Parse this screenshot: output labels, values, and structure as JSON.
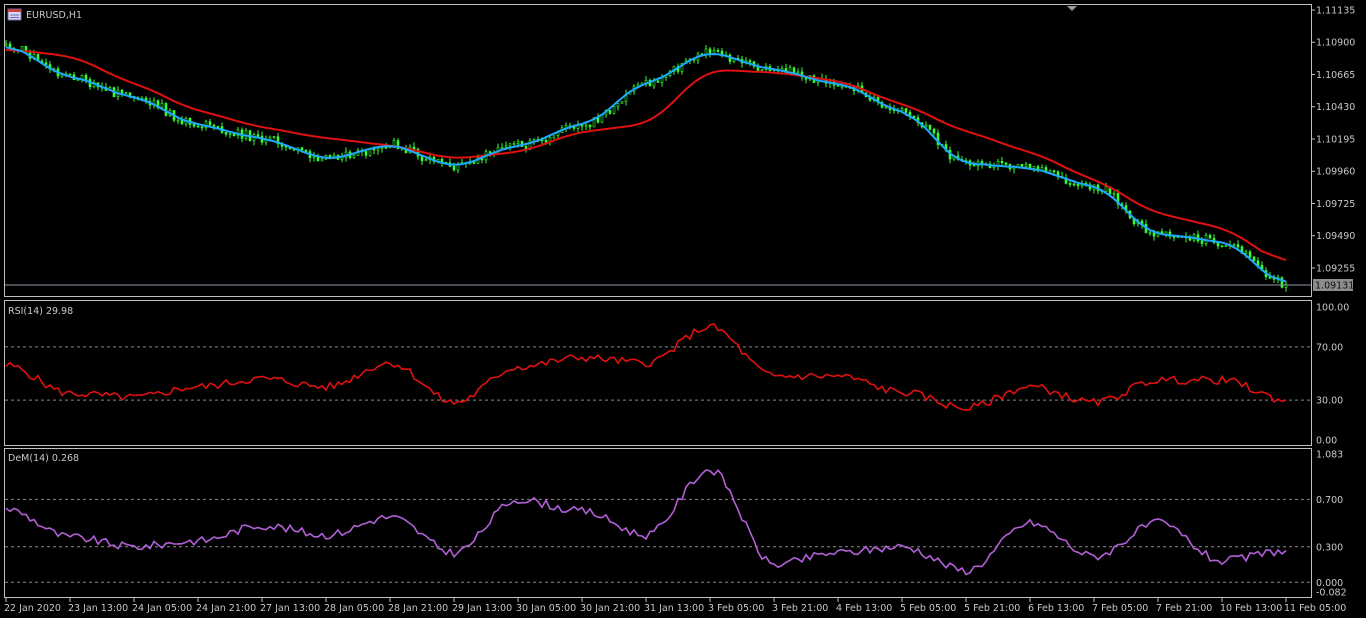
{
  "window": {
    "title": "EURUSD,H1",
    "symbol_icon": "chart-window-icon"
  },
  "colors": {
    "background": "#000000",
    "frame": "#c0c0c0",
    "grid_dash": "#8a8a8a",
    "candle_green": "#33ff33",
    "ma_fast": "#1ea8ff",
    "ma_slow": "#e01010",
    "rsi_line": "#e01010",
    "dem_line": "#b260d6",
    "current_price_box": "#8c8c8c"
  },
  "price_panel": {
    "ylabels": [
      "1.11135",
      "1.10900",
      "1.10665",
      "1.10430",
      "1.10195",
      "1.09960",
      "1.09725",
      "1.09490",
      "1.09255"
    ],
    "current_price": "1.09131"
  },
  "rsi_panel": {
    "label": "RSI(14) 29.98",
    "ylabels": [
      "100.00",
      "70.00",
      "30.00",
      "0.00"
    ],
    "levels": [
      70,
      30
    ]
  },
  "dem_panel": {
    "label": "DeM(14) 0.268",
    "ylabels": [
      "1.083",
      "0.700",
      "0.300",
      "0.000",
      "-0.082"
    ],
    "levels": [
      0.7,
      0.3,
      0.0
    ]
  },
  "time_axis": {
    "labels": [
      "22 Jan 2020",
      "23 Jan 13:00",
      "24 Jan 05:00",
      "24 Jan 21:00",
      "27 Jan 13:00",
      "28 Jan 05:00",
      "28 Jan 21:00",
      "29 Jan 13:00",
      "30 Jan 05:00",
      "30 Jan 21:00",
      "31 Jan 13:00",
      "3 Feb 05:00",
      "3 Feb 21:00",
      "4 Feb 13:00",
      "5 Feb 05:00",
      "5 Feb 21:00",
      "6 Feb 13:00",
      "7 Feb 05:00",
      "7 Feb 21:00",
      "10 Feb 13:00",
      "11 Feb 05:00"
    ]
  },
  "chart_data": [
    {
      "type": "line",
      "title": "EURUSD,H1",
      "x": [
        "22 Jan 2020",
        "23 Jan 13:00",
        "24 Jan 05:00",
        "24 Jan 21:00",
        "27 Jan 13:00",
        "28 Jan 05:00",
        "28 Jan 21:00",
        "29 Jan 13:00",
        "30 Jan 05:00",
        "30 Jan 21:00",
        "31 Jan 13:00",
        "3 Feb 05:00",
        "3 Feb 21:00",
        "4 Feb 13:00",
        "5 Feb 05:00",
        "5 Feb 21:00",
        "6 Feb 13:00",
        "7 Feb 05:00",
        "7 Feb 21:00",
        "10 Feb 13:00",
        "11 Feb 05:00"
      ],
      "series": [
        {
          "values": [
            1.1088,
            1.1065,
            1.105,
            1.103,
            1.102,
            1.1005,
            1.1015,
            1.1,
            1.1015,
            1.103,
            1.106,
            1.1082,
            1.107,
            1.106,
            1.104,
            1.1002,
            1.0998,
            1.0985,
            1.095,
            1.0945,
            1.0914
          ]
        },
        {
          "values": [
            1.1085,
            1.108,
            1.106,
            1.104,
            1.1028,
            1.102,
            1.1015,
            1.1005,
            1.101,
            1.1025,
            1.103,
            1.107,
            1.1068,
            1.1062,
            1.1045,
            1.1025,
            1.101,
            1.099,
            1.0965,
            1.0955,
            1.0928
          ]
        }
      ],
      "ylim": [
        1.09131,
        1.11135
      ],
      "current_price": 1.09131
    },
    {
      "type": "line",
      "title": "RSI(14) 29.98",
      "x": [
        "22 Jan 2020",
        "23 Jan 13:00",
        "24 Jan 05:00",
        "24 Jan 21:00",
        "27 Jan 13:00",
        "28 Jan 05:00",
        "28 Jan 21:00",
        "29 Jan 13:00",
        "30 Jan 05:00",
        "30 Jan 21:00",
        "31 Jan 13:00",
        "3 Feb 05:00",
        "3 Feb 21:00",
        "4 Feb 13:00",
        "5 Feb 05:00",
        "5 Feb 21:00",
        "6 Feb 13:00",
        "7 Feb 05:00",
        "7 Feb 21:00",
        "10 Feb 13:00",
        "11 Feb 05:00"
      ],
      "series": [
        {
          "values": [
            56,
            35,
            32,
            40,
            46,
            40,
            58,
            28,
            55,
            62,
            58,
            85,
            48,
            48,
            36,
            24,
            40,
            28,
            45,
            45,
            29.98
          ]
        }
      ],
      "ylim": [
        0,
        100
      ],
      "levels": [
        70,
        30
      ]
    },
    {
      "type": "line",
      "title": "DeM(14) 0.268",
      "x": [
        "22 Jan 2020",
        "23 Jan 13:00",
        "24 Jan 05:00",
        "24 Jan 21:00",
        "27 Jan 13:00",
        "28 Jan 05:00",
        "28 Jan 21:00",
        "29 Jan 13:00",
        "30 Jan 05:00",
        "30 Jan 21:00",
        "31 Jan 13:00",
        "3 Feb 05:00",
        "3 Feb 21:00",
        "4 Feb 13:00",
        "5 Feb 05:00",
        "5 Feb 21:00",
        "6 Feb 13:00",
        "7 Feb 05:00",
        "7 Feb 21:00",
        "10 Feb 13:00",
        "11 Feb 05:00"
      ],
      "series": [
        {
          "values": [
            0.62,
            0.38,
            0.3,
            0.35,
            0.48,
            0.4,
            0.55,
            0.25,
            0.7,
            0.6,
            0.4,
            0.95,
            0.15,
            0.25,
            0.3,
            0.1,
            0.5,
            0.22,
            0.5,
            0.18,
            0.268
          ]
        }
      ],
      "ylim": [
        -0.082,
        1.083
      ],
      "levels": [
        0.7,
        0.3,
        0.0
      ]
    }
  ]
}
